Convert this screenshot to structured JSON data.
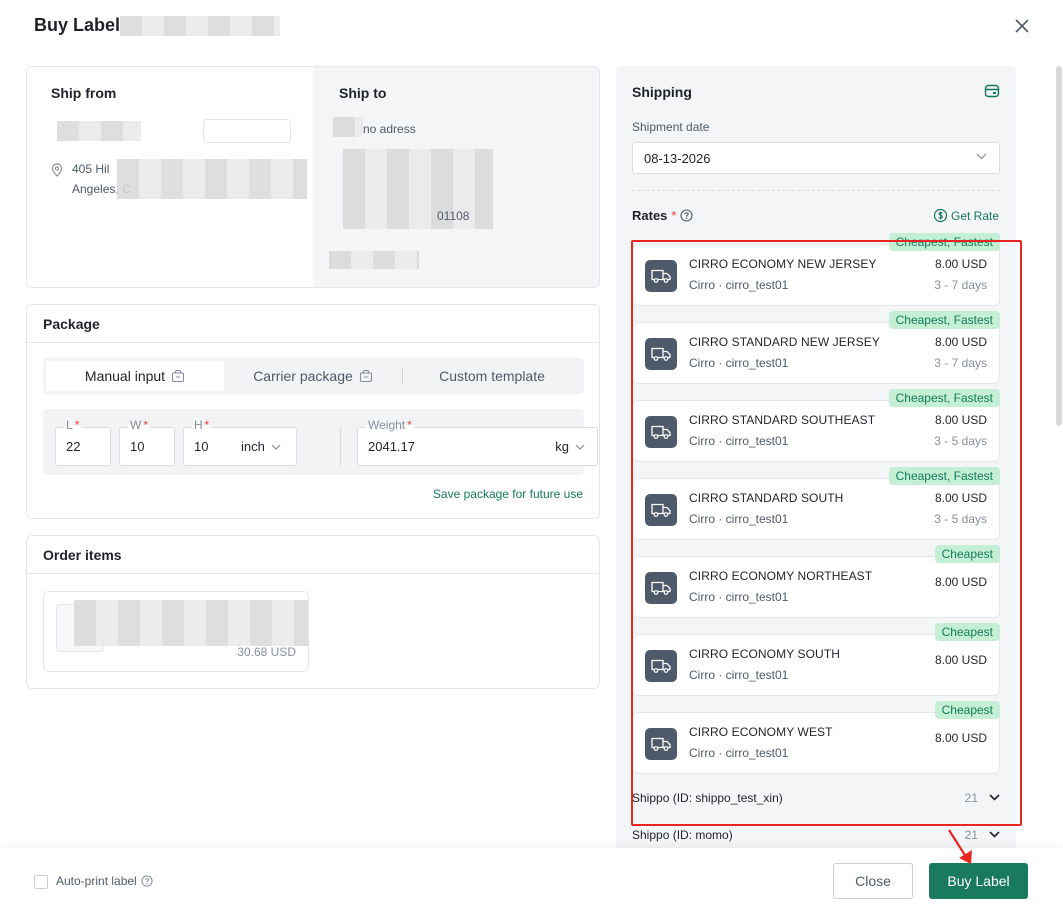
{
  "modal": {
    "title": "Buy Label"
  },
  "ship_from": {
    "title": "Ship from",
    "address_line1": "405 Hil",
    "address_line2": "Angeles, C"
  },
  "ship_to": {
    "title": "Ship to",
    "address_note": "no adress",
    "postal_fragment": "01108"
  },
  "package": {
    "title": "Package",
    "tabs": [
      {
        "label": "Manual input"
      },
      {
        "label": "Carrier package"
      },
      {
        "label": "Custom template"
      }
    ],
    "length": {
      "label": "L",
      "value": "22"
    },
    "width": {
      "label": "W",
      "value": "10"
    },
    "height": {
      "label": "H",
      "value": "10"
    },
    "dim_unit": "inch",
    "weight": {
      "label": "Weight",
      "value": "2041.17",
      "unit": "kg"
    },
    "save_link": "Save package for future use"
  },
  "order_items": {
    "title": "Order items",
    "item_price": "30.68 USD"
  },
  "shipping": {
    "title": "Shipping",
    "date_label": "Shipment date",
    "date_value": "08-13-2026",
    "rates_label": "Rates",
    "get_rate": "Get Rate",
    "rates": [
      {
        "name": "CIRRO ECONOMY NEW JERSEY",
        "carrier": "Cirro · cirro_test01",
        "price": "8.00 USD",
        "days": "3 - 7 days",
        "tag": "Cheapest, Fastest"
      },
      {
        "name": "CIRRO STANDARD NEW JERSEY",
        "carrier": "Cirro · cirro_test01",
        "price": "8.00 USD",
        "days": "3 - 7 days",
        "tag": "Cheapest, Fastest"
      },
      {
        "name": "CIRRO STANDARD SOUTHEAST",
        "carrier": "Cirro · cirro_test01",
        "price": "8.00 USD",
        "days": "3 - 5 days",
        "tag": "Cheapest, Fastest"
      },
      {
        "name": "CIRRO STANDARD SOUTH",
        "carrier": "Cirro · cirro_test01",
        "price": "8.00 USD",
        "days": "3 - 5 days",
        "tag": "Cheapest, Fastest"
      },
      {
        "name": "CIRRO ECONOMY NORTHEAST",
        "carrier": "Cirro · cirro_test01",
        "price": "8.00 USD",
        "days": "",
        "tag": "Cheapest"
      },
      {
        "name": "CIRRO ECONOMY SOUTH",
        "carrier": "Cirro · cirro_test01",
        "price": "8.00 USD",
        "days": "",
        "tag": "Cheapest"
      },
      {
        "name": "CIRRO ECONOMY WEST",
        "carrier": "Cirro · cirro_test01",
        "price": "8.00 USD",
        "days": "",
        "tag": "Cheapest"
      }
    ],
    "carriers": [
      {
        "label": "Shippo (ID: shippo_test_xin)",
        "count": "21"
      },
      {
        "label": "Shippo (ID: momo)",
        "count": "21"
      }
    ]
  },
  "footer": {
    "auto_print_label": "Auto-print label",
    "close_label": "Close",
    "buy_label": "Buy Label"
  },
  "colors": {
    "accent": "#1a7a5e",
    "tag_bg": "#c4efd4",
    "highlight": "#e8261f"
  }
}
